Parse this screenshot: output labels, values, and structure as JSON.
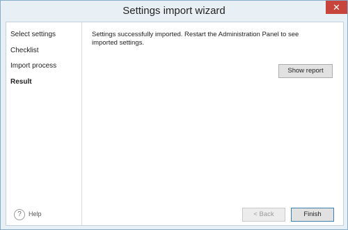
{
  "window": {
    "title": "Settings import wizard",
    "close_glyph": "✕"
  },
  "sidebar": {
    "items": [
      {
        "label": "Select settings",
        "active": false
      },
      {
        "label": "Checklist",
        "active": false
      },
      {
        "label": "Import process",
        "active": false
      },
      {
        "label": "Result",
        "active": true
      }
    ],
    "help": {
      "icon": "question-circle-icon",
      "glyph": "?",
      "label": "Help"
    }
  },
  "main": {
    "message": "Settings successfully imported. Restart the Administration Panel to see imported settings.",
    "show_report_label": "Show report"
  },
  "footer": {
    "back_label": "< Back",
    "finish_label": "Finish"
  },
  "colors": {
    "close_button": "#c7453c",
    "window_border": "#83adc8"
  }
}
